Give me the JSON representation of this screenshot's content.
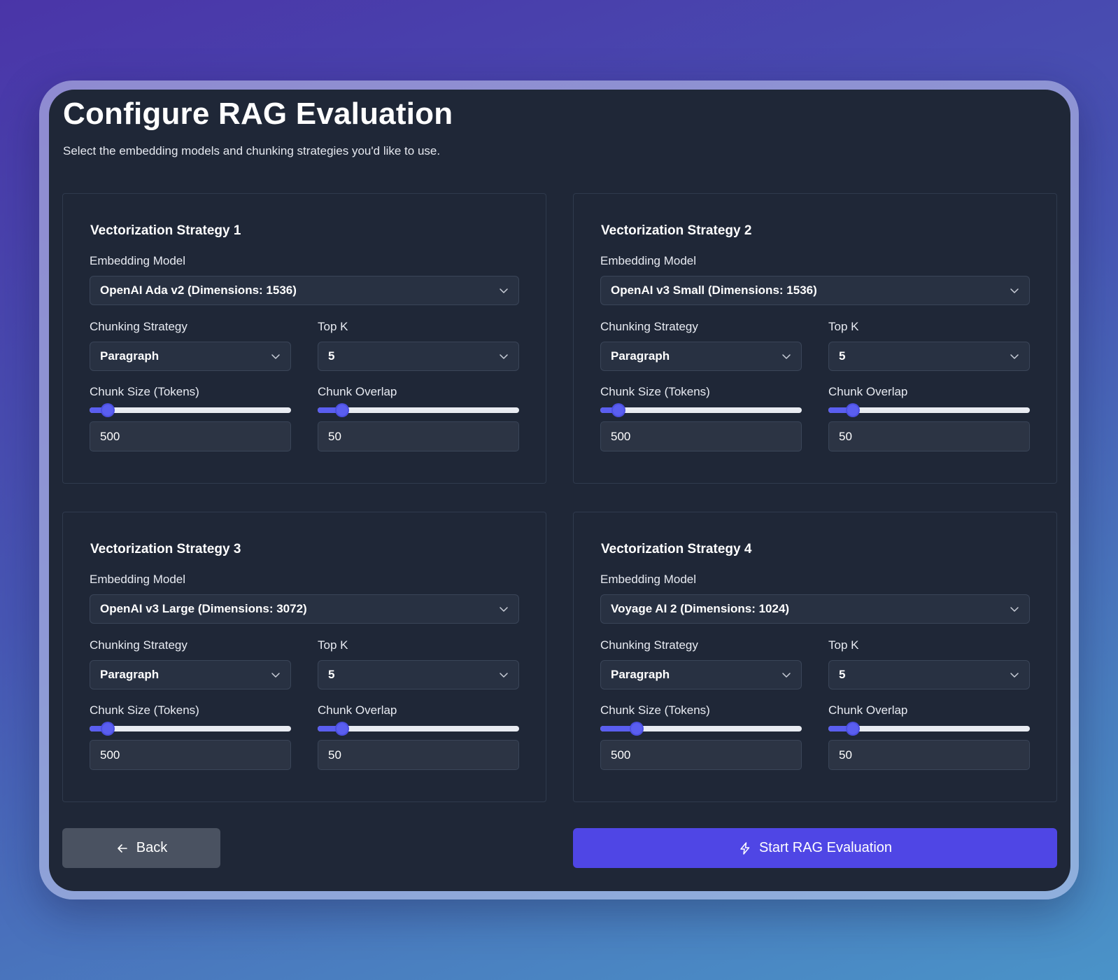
{
  "header": {
    "title": "Configure RAG Evaluation",
    "subtitle": "Select the embedding models and chunking strategies you'd like to use."
  },
  "labels": {
    "embedding_model": "Embedding Model",
    "chunking_strategy": "Chunking Strategy",
    "top_k": "Top K",
    "chunk_size": "Chunk Size (Tokens)",
    "chunk_overlap": "Chunk Overlap"
  },
  "strategies": [
    {
      "title": "Vectorization Strategy 1",
      "embedding_model": "OpenAI Ada v2 (Dimensions: 1536)",
      "chunking_strategy": "Paragraph",
      "top_k": "5",
      "chunk_size": "500",
      "chunk_overlap": "50",
      "chunk_size_fraction": 0.09,
      "chunk_overlap_fraction": 0.12
    },
    {
      "title": "Vectorization Strategy 2",
      "embedding_model": "OpenAI v3 Small (Dimensions: 1536)",
      "chunking_strategy": "Paragraph",
      "top_k": "5",
      "chunk_size": "500",
      "chunk_overlap": "50",
      "chunk_size_fraction": 0.09,
      "chunk_overlap_fraction": 0.12
    },
    {
      "title": "Vectorization Strategy 3",
      "embedding_model": "OpenAI v3 Large (Dimensions: 3072)",
      "chunking_strategy": "Paragraph",
      "top_k": "5",
      "chunk_size": "500",
      "chunk_overlap": "50",
      "chunk_size_fraction": 0.09,
      "chunk_overlap_fraction": 0.12
    },
    {
      "title": "Vectorization Strategy 4",
      "embedding_model": "Voyage AI 2 (Dimensions: 1024)",
      "chunking_strategy": "Paragraph",
      "top_k": "5",
      "chunk_size": "500",
      "chunk_overlap": "50",
      "chunk_size_fraction": 0.18,
      "chunk_overlap_fraction": 0.12
    }
  ],
  "footer": {
    "back_label": "Back",
    "start_label": "Start RAG Evaluation"
  },
  "icons": {
    "back": "arrow-left-icon",
    "start": "lightning-icon",
    "dropdown": "chevron-down-icon"
  },
  "colors": {
    "accent": "#4f46e5",
    "panel": "#1f2737"
  }
}
